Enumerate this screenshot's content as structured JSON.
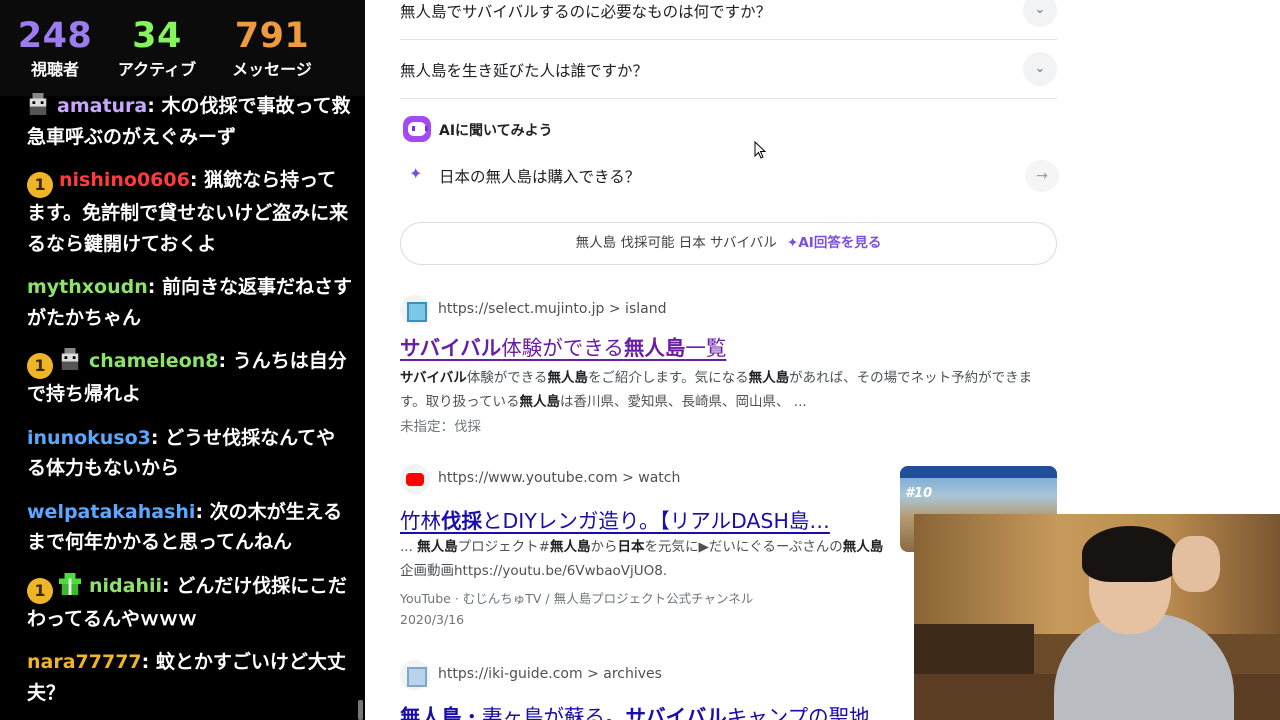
{
  "stats": {
    "viewers": {
      "value": "248",
      "label": "視聴者"
    },
    "active": {
      "value": "34",
      "label": "アクティブ"
    },
    "messages": {
      "value": "791",
      "label": "メッセージ"
    }
  },
  "chat": [
    {
      "user": "amatura",
      "color": "#c9a6ff",
      "text": "木の伐採で事故って救急車呼ぶのがえぐみーず",
      "badges": [
        "pixel-avatar"
      ]
    },
    {
      "user": "nishino0606",
      "color": "#ff3b3b",
      "text": "猟銃なら持ってます。免許制で貸せないけど盗みに来るなら鍵開けておくよ",
      "badges": [
        "1"
      ]
    },
    {
      "user": "mythxoudn",
      "color": "#8de36a",
      "text": "前向きな返事だねさすがたかちゃん",
      "badges": []
    },
    {
      "user": "chameleon8",
      "color": "#8de36a",
      "text": "うんちは自分で持ち帰れよ",
      "badges": [
        "1",
        "pixel-avatar"
      ]
    },
    {
      "user": "inunokuso3",
      "color": "#5aa8ff",
      "text": "どうせ伐採なんてやる体力もないから",
      "badges": []
    },
    {
      "user": "welpatakahashi",
      "color": "#5aa8ff",
      "text": "次の木が生えるまで何年かかると思ってんねん",
      "badges": []
    },
    {
      "user": "nidahii",
      "color": "#8de36a",
      "text": "どんだけ伐採にこだわってるんやｗｗｗ",
      "badges": [
        "1",
        "gift"
      ]
    },
    {
      "user": "nara77777",
      "color": "#f0b428",
      "text": "蚊とかすごいけど大丈夫？",
      "badges": []
    }
  ],
  "search": {
    "paa": [
      "無人島でサバイバルするのに必要なものは何ですか？",
      "無人島を生き延びた人は誰ですか？"
    ],
    "ai": {
      "title": "AIに聞いてみよう",
      "question": "日本の無人島は購入できる？",
      "pill_query": "無人島 伐採可能 日本 サバイバル",
      "pill_link": "AI回答を見る"
    },
    "results": [
      {
        "url": "https://select.mujinto.jp > island",
        "title_bold1": "サバイバル",
        "title_mid": "体験ができる",
        "title_bold2": "無人島",
        "title_tail": "一覧",
        "snip_b1": "サバイバル",
        "snip_t1": "体験ができる",
        "snip_b2": "無人島",
        "snip_t2": "をご紹介します。気になる",
        "snip_b3": "無人島",
        "snip_t3": "があれば、その場でネット予約ができます。取り扱っている",
        "snip_b4": "無人島",
        "snip_t4": "は香川県、愛知県、長崎県、岡山県、 ...",
        "meta": "未指定：伐採"
      },
      {
        "url": "https://www.youtube.com > watch",
        "title_pre": "竹林",
        "title_bold": "伐採",
        "title_post": "とDIYレンガ造り。【リアルDASH島…",
        "snip_t0": "... ",
        "snip_b1": "無人島",
        "snip_t1": "プロジェクト#",
        "snip_b2": "無人島",
        "snip_t2": "から",
        "snip_b3": "日本",
        "snip_t3": "を元気に▶だいにぐるーぷさんの",
        "snip_b4": "無人島",
        "snip_t4": "企画動画https://youtu.be/6VwbaoVjUO8.",
        "source": "YouTube",
        "channel": "むじんちゅTV / 無人島プロジェクト公式チャンネル",
        "date": "2020/3/16",
        "thumb_badge": "#10"
      },
      {
        "url": "https://iki-guide.com > archives",
        "title_b1": "無人島",
        "title_t1": "・妻ヶ島が蘇る。",
        "title_b2": "サバイバル",
        "title_t2": "キャンプの聖地"
      }
    ]
  }
}
